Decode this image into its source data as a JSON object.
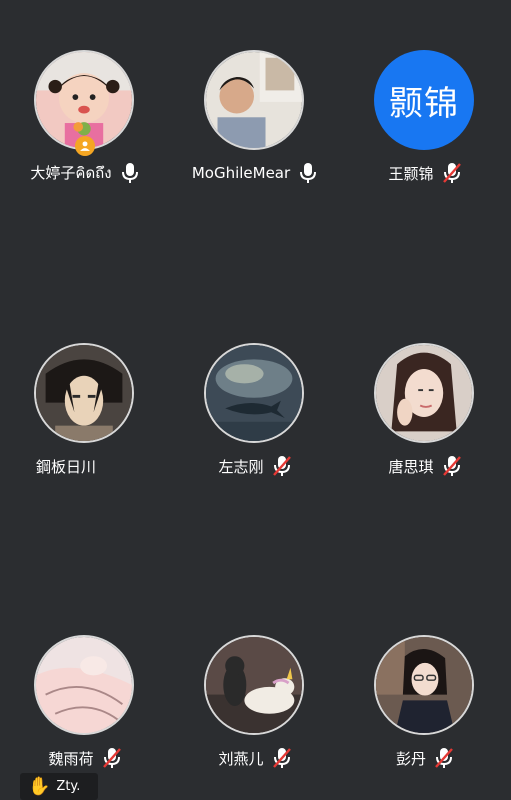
{
  "participants": [
    {
      "name": "大婷子คิดถึง",
      "mic": "on",
      "host": true
    },
    {
      "name": "MoGhileMear",
      "mic": "on"
    },
    {
      "name": "王颢锦",
      "mic": "muted",
      "avatar_text": "颢锦",
      "avatar_color": "#1877f2"
    },
    {
      "name": "鋼板日川",
      "mic": "none"
    },
    {
      "name": "左志刚",
      "mic": "muted"
    },
    {
      "name": "唐思琪",
      "mic": "muted"
    },
    {
      "name": "魏雨荷",
      "mic": "muted"
    },
    {
      "name": "刘燕儿",
      "mic": "muted"
    },
    {
      "name": "彭丹",
      "mic": "muted"
    }
  ],
  "raise_hand": {
    "icon": "raised-hand-icon",
    "label": "Zty."
  },
  "colors": {
    "background": "#2b2d30",
    "muted": "#e53935",
    "badge": "#f5a623"
  }
}
